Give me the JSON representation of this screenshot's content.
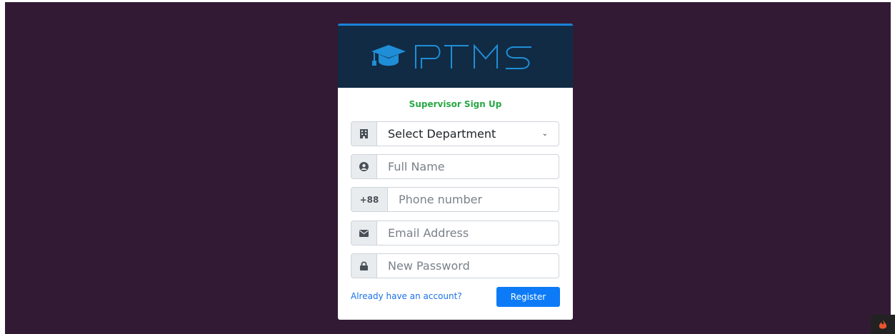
{
  "brand": {
    "logo_text": "PTMS",
    "cap_icon": "graduation-cap-icon"
  },
  "form": {
    "title": "Supervisor Sign Up",
    "department": {
      "selected": "Select Department",
      "icon": "building-icon"
    },
    "full_name": {
      "placeholder": "Full Name",
      "icon": "user-circle-icon"
    },
    "phone": {
      "prefix": "+88",
      "placeholder": "Phone number"
    },
    "email": {
      "placeholder": "Email Address",
      "icon": "envelope-icon"
    },
    "password": {
      "placeholder": "New Password",
      "icon": "lock-icon"
    },
    "login_link": "Already have an account?",
    "register_label": "Register"
  },
  "colors": {
    "page_bg": "#321a34",
    "header_bg": "#112b45",
    "accent": "#1a83d9",
    "title_green": "#28a745",
    "button_blue": "#0d7bf7"
  }
}
